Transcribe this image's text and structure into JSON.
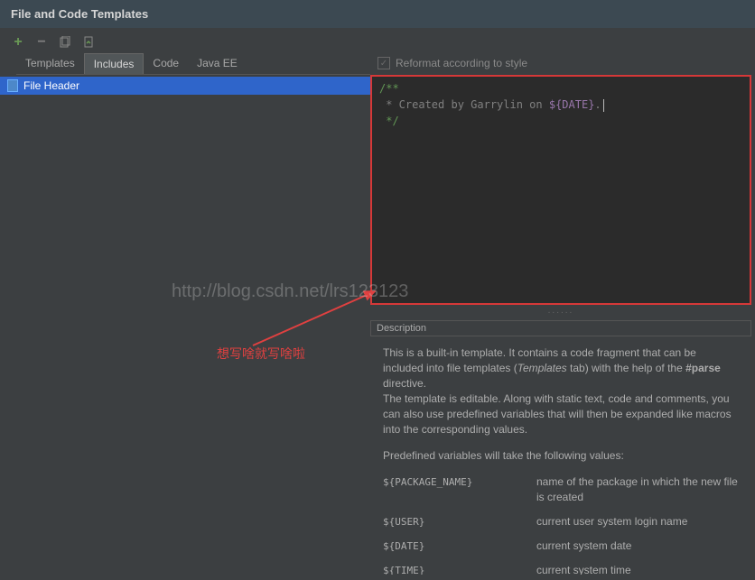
{
  "title": "File and Code Templates",
  "tabs": {
    "templates": "Templates",
    "includes": "Includes",
    "code": "Code",
    "javaee": "Java EE"
  },
  "tree": {
    "file_header": "File Header"
  },
  "checkbox_label": "Reformat according to style",
  "editor": {
    "line1": "/**",
    "line2_prefix": " * Created by Garrylin on ",
    "line2_var": "${DATE}",
    "line2_suffix": ".",
    "line3": " */"
  },
  "desc_title": "Description",
  "description": {
    "p1a": "This is a built-in template. It contains a code fragment that can be included into file templates (",
    "p1b": "Templates",
    "p1c": " tab) with the help of the ",
    "p1d": "#parse",
    "p1e": " directive.",
    "p2": "The template is editable. Along with static text, code and comments, you can also use predefined variables that will then be expanded like macros into the corresponding values.",
    "p3": "Predefined variables will take the following values:"
  },
  "variables": [
    {
      "name": "${PACKAGE_NAME}",
      "desc": "name of the package in which the new file is created"
    },
    {
      "name": "${USER}",
      "desc": "current user system login name"
    },
    {
      "name": "${DATE}",
      "desc": "current system date"
    },
    {
      "name": "${TIME}",
      "desc": "current system time"
    }
  ],
  "watermark": "http://blog.csdn.net/lrs123123",
  "annotation": "想写啥就写啥啦",
  "resize_dots": "......"
}
